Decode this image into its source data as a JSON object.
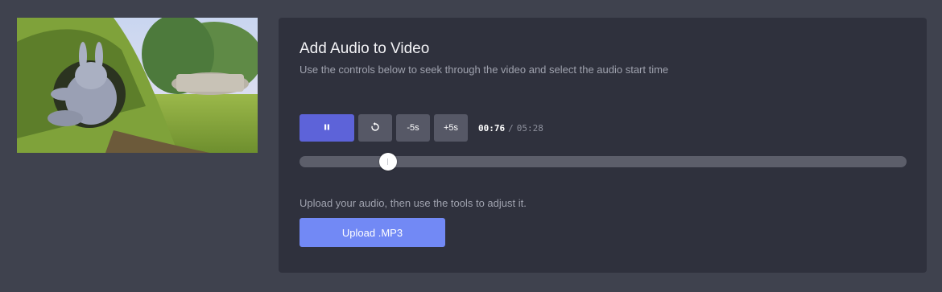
{
  "video": {
    "thumbnail_icon": "video-frame-image"
  },
  "panel": {
    "title": "Add Audio to Video",
    "description": "Use the controls below to seek through the video and select the audio start time"
  },
  "controls": {
    "play_pause_icon": "pause-icon",
    "restart_icon": "restart-icon",
    "back_label": "-5s",
    "forward_label": "+5s",
    "current_time": "00:76",
    "separator": "/",
    "duration": "05:28"
  },
  "seek": {
    "progress_fraction": 0.146
  },
  "upload": {
    "hint": "Upload your audio, then use the tools to adjust it.",
    "button_label": "Upload .MP3"
  },
  "colors": {
    "background": "#3f424e",
    "panel": "#2f313d",
    "primary": "#5d63d9",
    "upload": "#7289f5",
    "secondary_button": "#565866"
  }
}
